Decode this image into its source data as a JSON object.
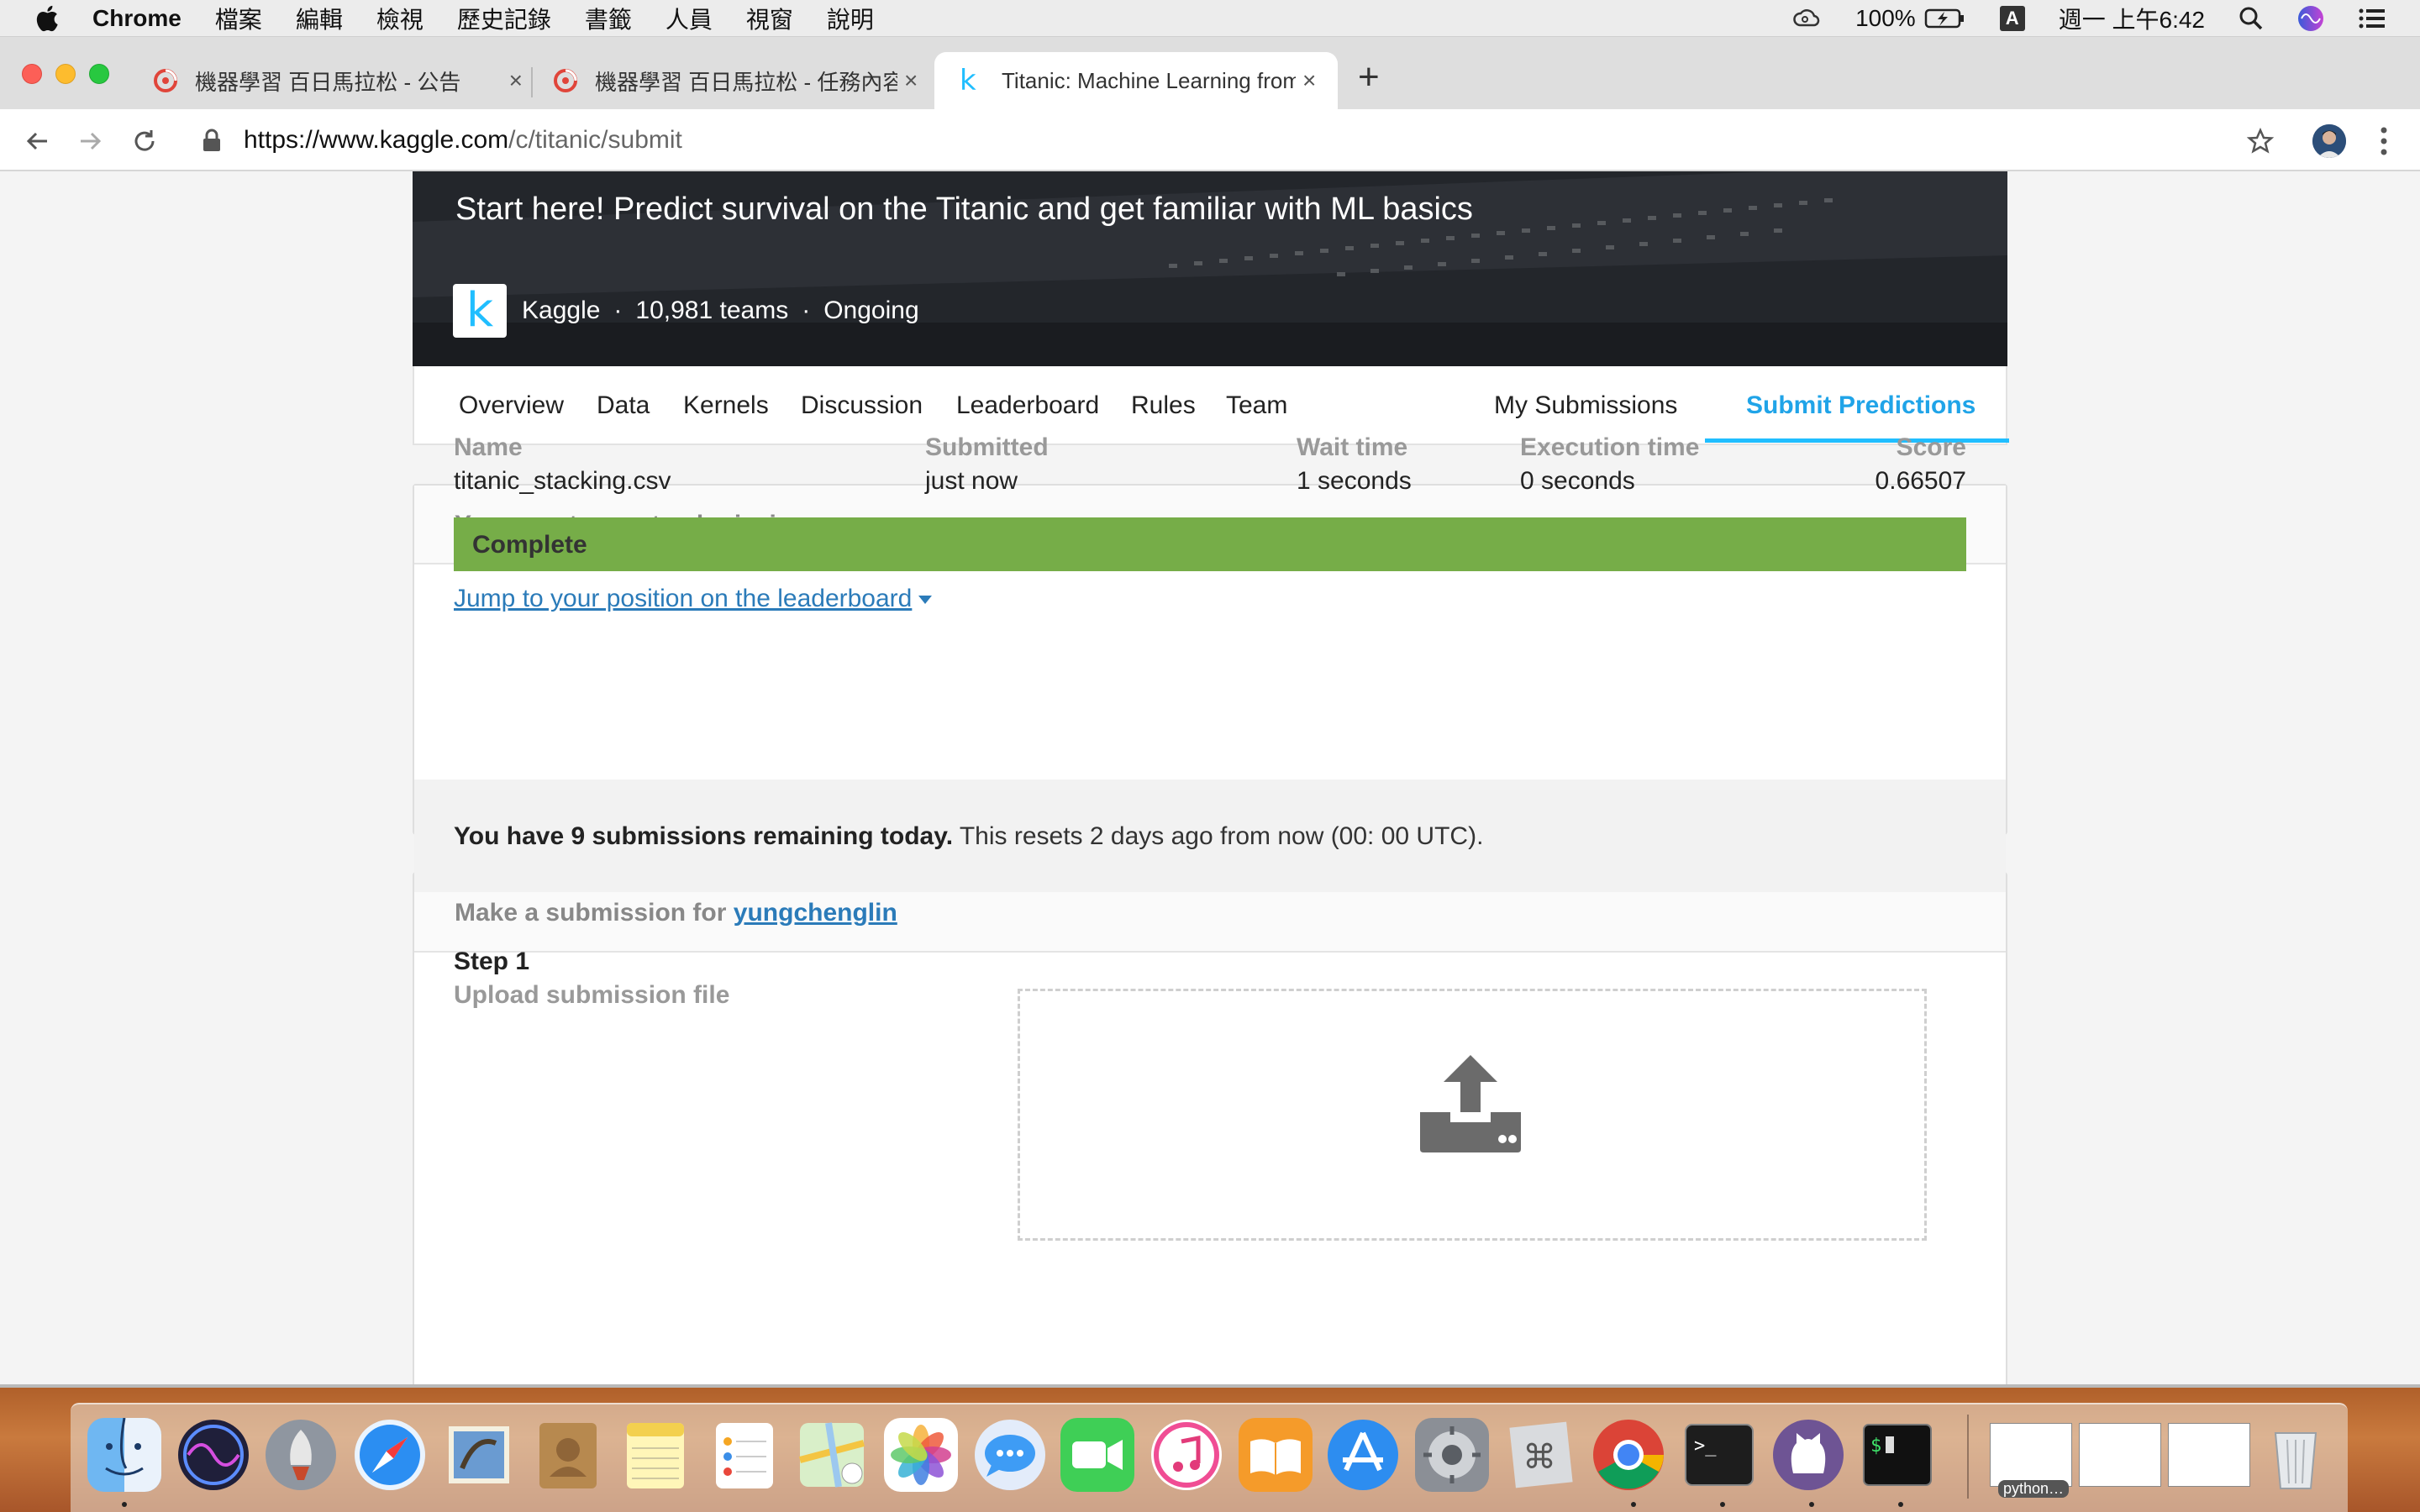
{
  "menubar": {
    "app": "Chrome",
    "items": [
      "檔案",
      "編輯",
      "檢視",
      "歷史記錄",
      "書籤",
      "人員",
      "視窗",
      "說明"
    ],
    "battery": "100%",
    "input_method": "A",
    "clock": "週一 上午6:42"
  },
  "tabs": [
    {
      "title": "機器學習 百日馬拉松 - 公告",
      "icon": "cupoy-icon"
    },
    {
      "title": "機器學習 百日馬拉松 - 任務內容",
      "icon": "cupoy-icon"
    },
    {
      "title": "Titanic: Machine Learning from Disaster",
      "icon": "kaggle-k-icon"
    }
  ],
  "newtab_label": "+",
  "close_glyph": "×",
  "url": {
    "host": "https://www.kaggle.com",
    "path": "/c/titanic/submit"
  },
  "hero": {
    "headline": "Start here! Predict survival on the Titanic and get familiar with ML basics",
    "logo_letter": "k",
    "host": "Kaggle",
    "sep": "·",
    "teams": "10,981 teams",
    "status": "Ongoing"
  },
  "subnav": {
    "left": [
      "Overview",
      "Data",
      "Kernels",
      "Discussion",
      "Leaderboard",
      "Rules",
      "Team"
    ],
    "my_submissions": "My Submissions",
    "submit_predictions": "Submit Predictions"
  },
  "recent": {
    "header": "Your most recent submission",
    "columns": [
      "Name",
      "Submitted",
      "Wait time",
      "Execution time",
      "Score"
    ],
    "values": [
      "titanic_stacking.csv",
      "just now",
      "1 seconds",
      "0 seconds",
      "0.66507"
    ],
    "status": "Complete",
    "jump_link": "Jump to your position on the leaderboard"
  },
  "make": {
    "header_prefix": "Make a submission for",
    "username": "yungchenglin",
    "notice_bold": "You have 9 submissions remaining today.",
    "notice_rest": " This resets 2 days ago from now (00: 00 UTC).",
    "step_title": "Step 1",
    "step_subtitle": "Upload submission file"
  },
  "dock": {
    "apps": [
      "Finder",
      "Siri",
      "Launchpad",
      "Safari",
      "Mail",
      "Contacts",
      "Notes",
      "Reminders",
      "Maps",
      "Photos",
      "Messages",
      "FaceTime",
      "iTunes",
      "iBooks",
      "App Store",
      "System Preferences",
      "Script Editor",
      "Chrome",
      "Terminal",
      "GitHub Desktop",
      "iTerm"
    ],
    "thumb_label": "python…"
  },
  "colors": {
    "kaggle_blue": "#20beff",
    "link_blue": "#2b7bb9",
    "complete_green": "#76ad48"
  }
}
